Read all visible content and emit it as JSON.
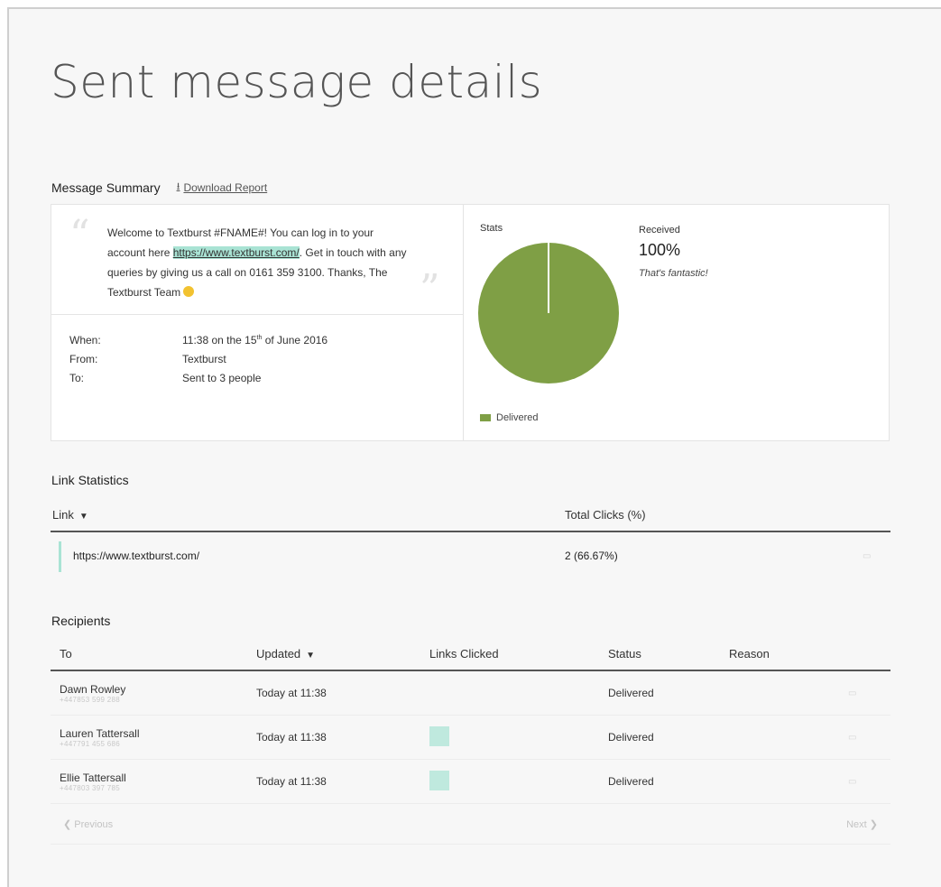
{
  "page_title": "Sent message details",
  "summary": {
    "heading": "Message Summary",
    "download_label": "Download Report",
    "download_icon": "download-icon",
    "message": {
      "text_before": "Welcome to Textburst #FNAME#! You can log in to your account here ",
      "link": "https://www.textburst.com/",
      "text_after": ". Get in touch with any queries by giving us a call on 0161 359 3100. Thanks, The Textburst Team "
    },
    "meta": [
      {
        "key": "When:",
        "value": "11:38 on the 15th of June 2016"
      },
      {
        "key": "From:",
        "value": "Textburst"
      },
      {
        "key": "To:",
        "value": "Sent to 3 people"
      }
    ],
    "stats": {
      "label": "Stats",
      "received_label": "Received",
      "received_value": "100%",
      "received_note": "That's fantastic!",
      "legend": "Delivered",
      "delivered_color": "#7f9f45"
    }
  },
  "link_statistics": {
    "title": "Link Statistics",
    "columns": [
      "Link",
      "Total Clicks (%)"
    ],
    "rows": [
      {
        "link": "https://www.textburst.com/",
        "clicks": "2 (66.67%)"
      }
    ]
  },
  "recipients": {
    "title": "Recipients",
    "columns": [
      "To",
      "Updated",
      "Links Clicked",
      "Status",
      "Reason"
    ],
    "rows": [
      {
        "name": "Dawn Rowley",
        "phone": "+447853 599 288",
        "updated": "Today at 11:38",
        "clicked": false,
        "status": "Delivered"
      },
      {
        "name": "Lauren Tattersall",
        "phone": "+447791 455 686",
        "updated": "Today at 11:38",
        "clicked": true,
        "status": "Delivered"
      },
      {
        "name": "Ellie Tattersall",
        "phone": "+447803 397 785",
        "updated": "Today at 11:38",
        "clicked": true,
        "status": "Delivered"
      }
    ],
    "pager": {
      "previous": "Previous",
      "next": "Next"
    }
  },
  "colors": {
    "accent": "#a9e3d4",
    "pie": "#7f9f45"
  }
}
